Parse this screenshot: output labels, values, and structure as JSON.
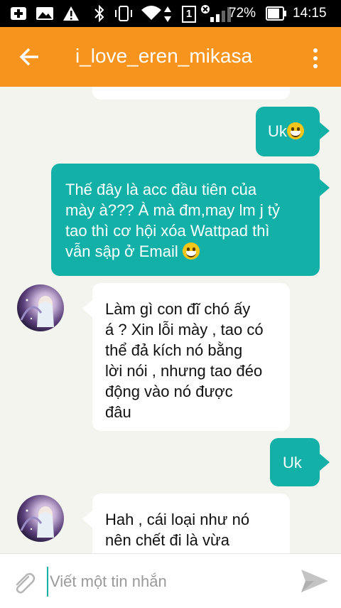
{
  "status_bar": {
    "battery_percent": "72%",
    "time": "14:15",
    "sim_slot": "1"
  },
  "header": {
    "title": "i_love_eren_mikasa"
  },
  "messages": [
    {
      "side": "sent",
      "text": "Uk",
      "emoji": true
    },
    {
      "side": "sent",
      "lines": [
        "Thế đây là acc đầu tiên của",
        "mày à??? À mà đm,may lm j tỷ",
        "tao thì cơ hội xóa Wattpad thì",
        "vẫn sập ở Email"
      ],
      "emoji": true
    },
    {
      "side": "received",
      "lines": [
        "Làm gì con đĩ chó ấy",
        "á ? Xin lỗi mày , tao có",
        "thể đả kích nó bằng",
        "lời nói , nhưng tao đéo",
        "động vào nó được",
        "đâu"
      ]
    },
    {
      "side": "sent",
      "text": "Uk"
    },
    {
      "side": "received",
      "lines": [
        "Hah , cái loại như nó",
        "nên chết đi là vừa"
      ]
    }
  ],
  "composer": {
    "placeholder": "Viết một tin nhắn"
  },
  "colors": {
    "app_bar": "#f7941d",
    "sent_bubble": "#12b0a7",
    "background": "#f3f4ee"
  }
}
